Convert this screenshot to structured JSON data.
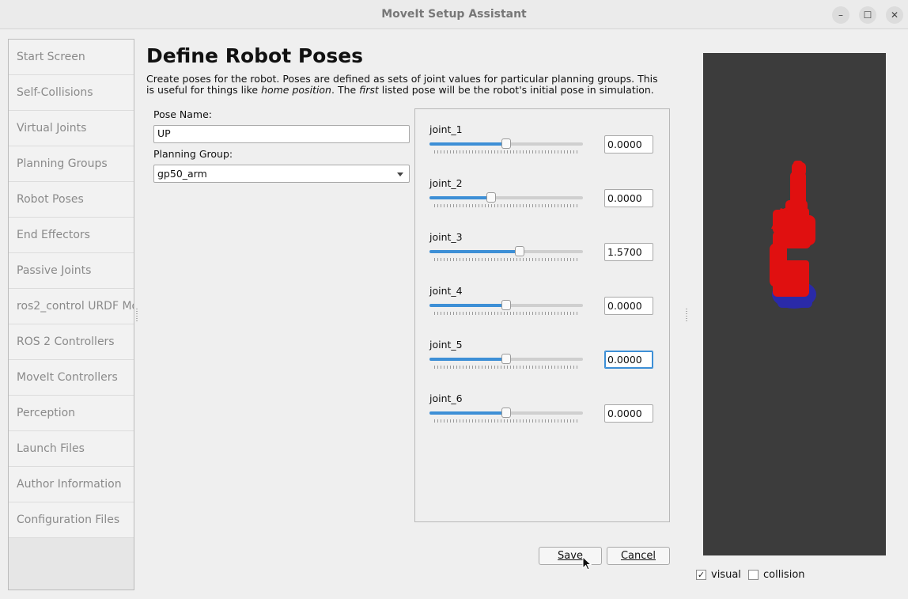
{
  "window": {
    "title": "MoveIt Setup Assistant",
    "minimize_icon": "–",
    "maximize_icon": "☐",
    "close_icon": "✕"
  },
  "sidebar": {
    "items": [
      {
        "label": "Start Screen"
      },
      {
        "label": "Self-Collisions"
      },
      {
        "label": "Virtual Joints"
      },
      {
        "label": "Planning Groups"
      },
      {
        "label": "Robot Poses"
      },
      {
        "label": "End Effectors"
      },
      {
        "label": "Passive Joints"
      },
      {
        "label": "ros2_control URDF Mo"
      },
      {
        "label": "ROS 2 Controllers"
      },
      {
        "label": "MoveIt Controllers"
      },
      {
        "label": "Perception"
      },
      {
        "label": "Launch Files"
      },
      {
        "label": "Author Information"
      },
      {
        "label": "Configuration Files"
      }
    ]
  },
  "page": {
    "title": "Define Robot Poses",
    "desc_1": "Create poses for the robot. Poses are defined as sets of joint values for particular planning groups. This is useful for things like ",
    "desc_em1": "home position",
    "desc_2": ". The ",
    "desc_em2": "first",
    "desc_3": " listed pose will be the robot's initial pose in simulation."
  },
  "form": {
    "pose_name_label": "Pose Name:",
    "pose_name_value": "UP",
    "planning_group_label": "Planning Group:",
    "planning_group_value": "gp50_arm"
  },
  "joints": [
    {
      "name": "joint_1",
      "value": "0.0000",
      "slider_fraction": 0.5
    },
    {
      "name": "joint_2",
      "value": "0.0000",
      "slider_fraction": 0.4
    },
    {
      "name": "joint_3",
      "value": "1.5700",
      "slider_fraction": 0.59
    },
    {
      "name": "joint_4",
      "value": "0.0000",
      "slider_fraction": 0.5
    },
    {
      "name": "joint_5",
      "value": "0.0000",
      "slider_fraction": 0.5
    },
    {
      "name": "joint_6",
      "value": "0.0000",
      "slider_fraction": 0.5
    }
  ],
  "buttons": {
    "save": "Save",
    "cancel": "Cancel"
  },
  "viewer": {
    "visual_label": "visual",
    "visual_checked": true,
    "collision_label": "collision",
    "collision_checked": false,
    "robot_color": "#e01010",
    "base_color": "#2a2aa8"
  },
  "colors": {
    "accent": "#3d8fd6"
  }
}
